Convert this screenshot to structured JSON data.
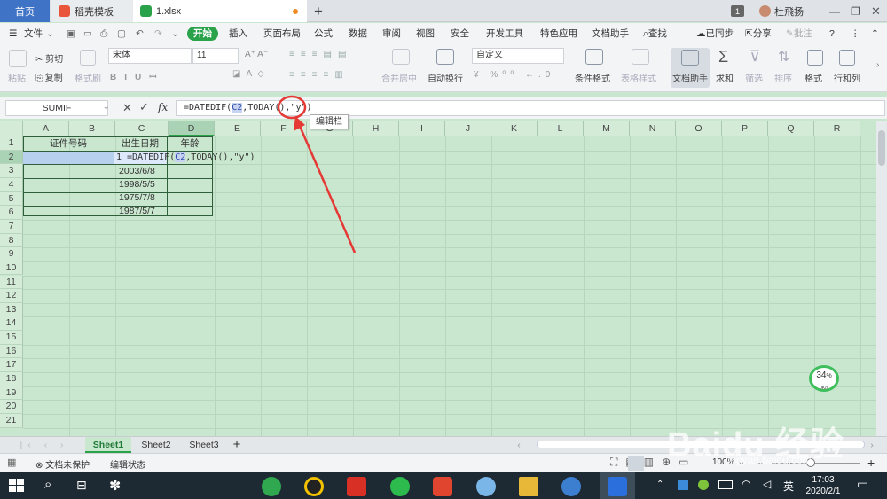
{
  "tabs": {
    "home": "首页",
    "template": "稻壳模板",
    "file": "1.xlsx",
    "new_tab": "+",
    "badge": "1",
    "user": "杜飛扬"
  },
  "menu": {
    "file": "文件",
    "items": [
      "开始",
      "插入",
      "页面布局",
      "公式",
      "数据",
      "审阅",
      "视图",
      "安全",
      "开发工具",
      "特色应用",
      "文档助手"
    ],
    "search": "查找",
    "sync": "已同步",
    "share": "分享",
    "annotate": "批注"
  },
  "ribbon": {
    "paste": "粘贴",
    "cut": "剪切",
    "copy": "复制",
    "format_painter": "格式刷",
    "font_name": "宋体",
    "font_size": "11",
    "merge": "合并居中",
    "wrap": "自动换行",
    "number_format": "自定义",
    "cond_format": "条件格式",
    "table_style": "表格样式",
    "doc_helper": "文档助手",
    "sum": "求和",
    "filter": "筛选",
    "sort": "排序",
    "format": "格式",
    "row_col": "行和列"
  },
  "formula_bar": {
    "name_box": "SUMIF",
    "fx": "fx",
    "formula_pre": "=DATEDIF(",
    "formula_ref": "C2",
    "formula_post": ",TODAY(),\"y\")",
    "tooltip": "编辑栏"
  },
  "columns": [
    "A",
    "B",
    "C",
    "D",
    "E",
    "F",
    "G",
    "H",
    "I",
    "J",
    "K",
    "L",
    "M",
    "N",
    "O",
    "P",
    "Q",
    "R"
  ],
  "rows": [
    "1",
    "2",
    "3",
    "4",
    "5",
    "6",
    "7",
    "8",
    "9",
    "10",
    "11",
    "12",
    "13",
    "14",
    "15",
    "16",
    "17",
    "18",
    "19",
    "20",
    "21"
  ],
  "cells": {
    "a1": "证件号码",
    "c1": "出生日期",
    "d1": "年龄",
    "c2_pre": "1 =DATEDIF(",
    "c2_ref": "C2",
    "c2_post": ",TODAY(),\"y\")",
    "c3": "2003/6/8",
    "c4": "1998/5/5",
    "c5": "1975/7/8",
    "c6": "1987/5/7"
  },
  "sheets": [
    "Sheet1",
    "Sheet2",
    "Sheet3"
  ],
  "status": {
    "protect": "文档未保护",
    "mode": "编辑状态",
    "zoom": "100%"
  },
  "widget": {
    "percent": "34",
    "unit": "%",
    "speed": "0K/s"
  },
  "taskbar": {
    "ime": "英",
    "time": "17:03",
    "date": "2020/2/1"
  },
  "watermark": "Baidu 经验",
  "watermark_url": "jingyan.baidu.com",
  "colors": {
    "accent": "#3f73c6",
    "start_green": "#2aa24a",
    "grid_bg": "#c9e6cf",
    "annotation": "#e53935"
  }
}
